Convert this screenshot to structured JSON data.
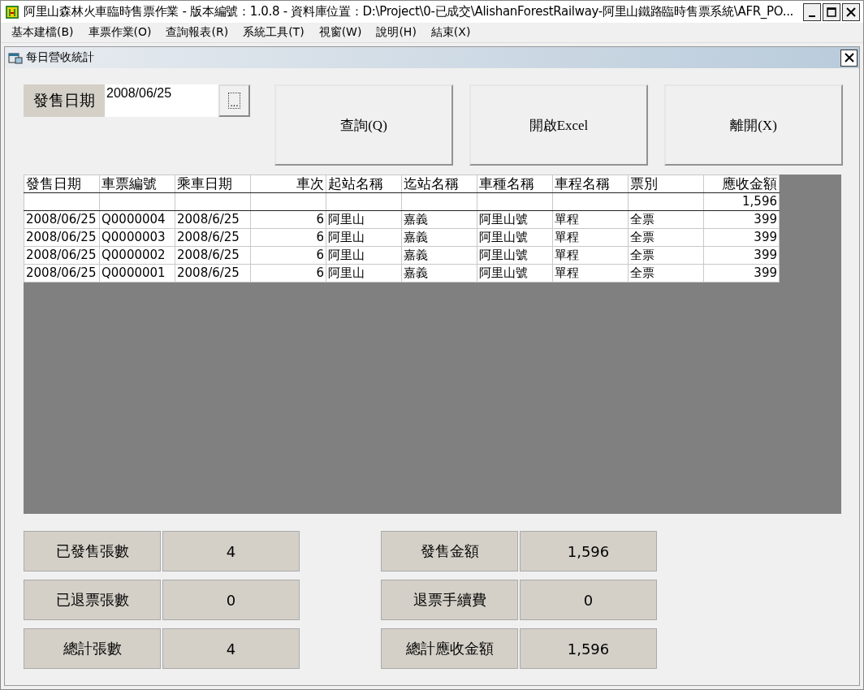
{
  "window": {
    "title": "阿里山森林火車臨時售票作業 - 版本編號：1.0.8 - 資料庫位置：D:\\Project\\0-已成交\\AlishanForestRailway-阿里山鐵路臨時售票系統\\AFR_PO..."
  },
  "menu": [
    "基本建檔(B)",
    "車票作業(O)",
    "查詢報表(R)",
    "系統工具(T)",
    "視窗(W)",
    "說明(H)",
    "結束(X)"
  ],
  "child_window": {
    "title": "每日營收統計"
  },
  "date_filter": {
    "label": "發售日期",
    "value": "2008/06/25",
    "picker_button": "..."
  },
  "buttons": [
    "查詢(Q)",
    "開啟Excel",
    "離開(X)"
  ],
  "table": {
    "columns": [
      "發售日期",
      "車票編號",
      "乘車日期",
      "車次",
      "起站名稱",
      "迄站名稱",
      "車種名稱",
      "車程名稱",
      "票別",
      "應收金額"
    ],
    "total_amount": "1,596",
    "rows": [
      [
        "2008/06/25",
        "Q0000004",
        "2008/6/25",
        "6",
        "阿里山",
        "嘉義",
        "阿里山號",
        "單程",
        "全票",
        "399"
      ],
      [
        "2008/06/25",
        "Q0000003",
        "2008/6/25",
        "6",
        "阿里山",
        "嘉義",
        "阿里山號",
        "單程",
        "全票",
        "399"
      ],
      [
        "2008/06/25",
        "Q0000002",
        "2008/6/25",
        "6",
        "阿里山",
        "嘉義",
        "阿里山號",
        "單程",
        "全票",
        "399"
      ],
      [
        "2008/06/25",
        "Q0000001",
        "2008/6/25",
        "6",
        "阿里山",
        "嘉義",
        "阿里山號",
        "單程",
        "全票",
        "399"
      ]
    ]
  },
  "summary_left": [
    {
      "label": "已發售張數",
      "value": "4"
    },
    {
      "label": "已退票張數",
      "value": "0"
    },
    {
      "label": "總計張數",
      "value": "4"
    }
  ],
  "summary_right": [
    {
      "label": "發售金額",
      "value": "1,596"
    },
    {
      "label": "退票手續費",
      "value": "0"
    },
    {
      "label": "總計應收金額",
      "value": "1,596"
    }
  ]
}
